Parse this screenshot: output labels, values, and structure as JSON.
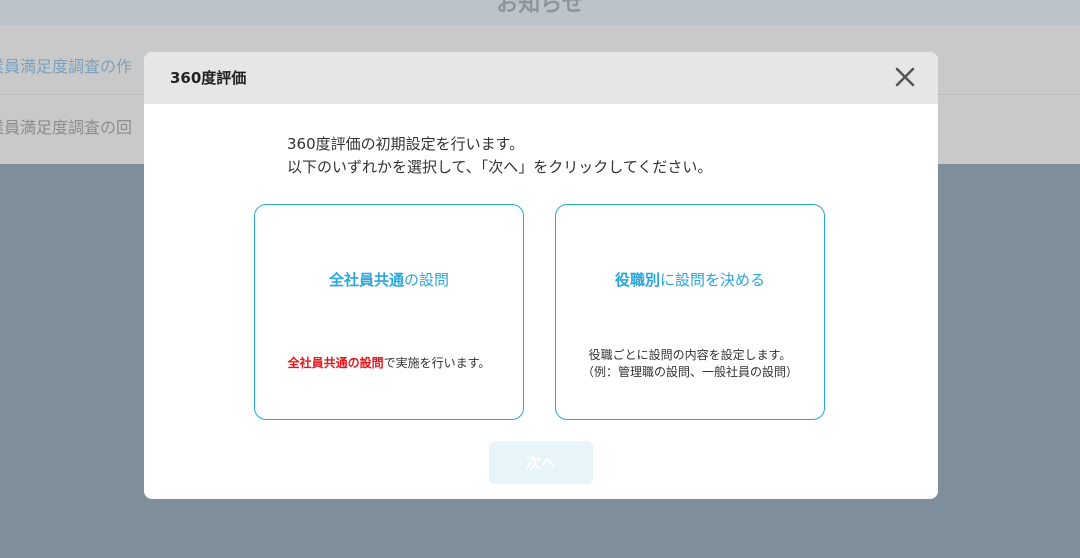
{
  "background": {
    "header_title": "お知らせ",
    "rows": [
      "業員満足度調査の作",
      "業員満足度調査の回"
    ]
  },
  "modal": {
    "title": "360度評価",
    "close_icon": "close-icon",
    "intro": [
      "360度評価の初期設定を行います。",
      "以下のいずれかを選択して、「次へ」をクリックしてください。"
    ],
    "options": [
      {
        "title_strong": "全社員共通",
        "title_rest": "の設問",
        "desc_strong": "全社員共通の設問",
        "desc_rest": "で実施を行います。"
      },
      {
        "title_strong": "役職別",
        "title_rest": "に設問を決める",
        "desc_line1": "役職ごとに設問の内容を設定します。",
        "desc_line2": "（例：管理職の設問、一般社員の設問）"
      }
    ],
    "next_label": "次へ"
  },
  "colors": {
    "accent": "#29a6dd",
    "emphasis_red": "#e8141b",
    "overlay": "#7f8e9b",
    "next_disabled": "#e7f5fb"
  }
}
